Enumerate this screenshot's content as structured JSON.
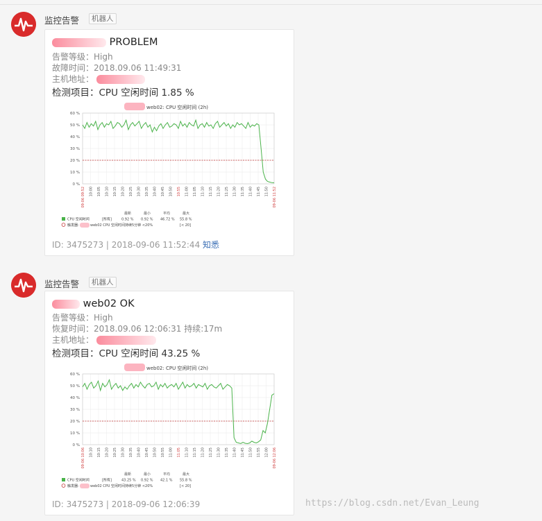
{
  "messages": [
    {
      "sender": "监控告警",
      "bot_tag": "机器人",
      "title": "PROBLEM",
      "level": "告警等级：High",
      "time": "故障时间：2018.09.06 11:49:31",
      "host_label": "主机地址：",
      "check": "检测项目：CPU 空闲时间 1.85 %",
      "chart_title": "web02: CPU 空闲时间 (2h)",
      "legend_header": [
        "最新",
        "最小",
        "平均",
        "最大"
      ],
      "legend_series": "CPU 空闲时间",
      "legend_scope": "[所有]",
      "legend_values": [
        "0.92 %",
        "0.92 %",
        "46.72 %",
        "55.8 %"
      ],
      "trigger_prefix": "触发器:",
      "trigger_text": "web02 CPU 空闲时间持续5分钟 <20%",
      "trigger_bracket": "[< 20]",
      "footer": "ID: 3475273 | 2018-09-06 11:52:44",
      "ack": "知悉"
    },
    {
      "sender": "监控告警",
      "bot_tag": "机器人",
      "title": "web02 OK",
      "level": "告警等级：High",
      "time": "恢复时间：2018.09.06 12:06:31 持续:17m",
      "host_label": "主机地址：",
      "check": "检测项目：CPU 空闲时间 43.25 %",
      "chart_title": "web02: CPU 空闲时间 (2h)",
      "legend_header": [
        "最新",
        "最小",
        "平均",
        "最大"
      ],
      "legend_series": "CPU 空闲时间",
      "legend_scope": "[所有]",
      "legend_values": [
        "43.25 %",
        "0.92 %",
        "42.1 %",
        "55.8 %"
      ],
      "trigger_prefix": "触发器:",
      "trigger_text": "web02 CPU 空闲时间持续5分钟 <20%",
      "trigger_bracket": "[< 20]",
      "footer": "ID: 3475273 | 2018-09-06 12:06:39"
    }
  ],
  "chart_data": [
    {
      "type": "line",
      "title": "web02: CPU 空闲时间 (2h)",
      "yticks": [
        "60 %",
        "50 %",
        "40 %",
        "30 %",
        "20 %",
        "10 %",
        "0 %"
      ],
      "ylim": [
        0,
        60
      ],
      "threshold": 20,
      "xticks": [
        "09-06 09:52",
        "10:00",
        "10:05",
        "10:10",
        "10:15",
        "10:20",
        "10:25",
        "10:30",
        "10:35",
        "10:40",
        "10:45",
        "10:50",
        "10:55",
        "11:00",
        "11:05",
        "11:10",
        "11:15",
        "11:20",
        "11:25",
        "11:30",
        "11:35",
        "11:40",
        "11:45",
        "11:50",
        "09-06 11:52"
      ],
      "series": [
        {
          "name": "CPU 空闲时间",
          "color": "#4ab34a",
          "values": [
            50,
            47,
            52,
            48,
            51,
            49,
            53,
            46,
            50,
            52,
            48,
            51,
            50,
            53,
            47,
            49,
            52,
            51,
            48,
            50,
            54,
            46,
            50,
            52,
            49,
            51,
            53,
            47,
            50,
            52,
            48,
            50,
            44,
            48,
            45,
            49,
            51,
            47,
            50,
            52,
            48,
            49,
            51,
            50,
            47,
            53,
            49,
            51,
            48,
            52,
            50,
            49,
            54,
            47,
            50,
            51,
            48,
            52,
            49,
            50,
            47,
            51,
            53,
            48,
            50,
            52,
            49,
            51,
            47,
            50,
            48,
            52,
            50,
            51,
            49,
            47,
            52,
            48,
            50,
            49,
            51,
            50,
            30,
            10,
            4,
            2,
            1.5,
            1,
            0.9
          ]
        }
      ]
    },
    {
      "type": "line",
      "title": "web02: CPU 空闲时间 (2h)",
      "yticks": [
        "60 %",
        "50 %",
        "40 %",
        "30 %",
        "20 %",
        "10 %",
        "0 %"
      ],
      "ylim": [
        0,
        60
      ],
      "threshold": 20,
      "xticks": [
        "09-06 10:06",
        "10:10",
        "10:15",
        "10:20",
        "10:25",
        "10:30",
        "10:35",
        "10:40",
        "10:45",
        "10:50",
        "10:55",
        "11:00",
        "11:05",
        "11:10",
        "11:15",
        "11:20",
        "11:25",
        "11:30",
        "11:35",
        "11:40",
        "11:45",
        "11:50",
        "11:55",
        "12:00",
        "09-06 12:06"
      ],
      "series": [
        {
          "name": "CPU 空闲时间",
          "color": "#4ab34a",
          "values": [
            49,
            52,
            47,
            51,
            53,
            48,
            50,
            54,
            46,
            52,
            49,
            51,
            55,
            47,
            50,
            52,
            48,
            50,
            46,
            49,
            47,
            50,
            52,
            48,
            51,
            49,
            53,
            50,
            48,
            51,
            52,
            49,
            50,
            53,
            47,
            51,
            49,
            52,
            48,
            50,
            51,
            49,
            52,
            47,
            50,
            53,
            48,
            51,
            49,
            50,
            52,
            48,
            51,
            50,
            49,
            52,
            47,
            50,
            51,
            49,
            48,
            50,
            52,
            47,
            49,
            51,
            50,
            48,
            6,
            2,
            1.5,
            1,
            2,
            1.2,
            0.9,
            1.5,
            3,
            2,
            1.5,
            2.5,
            4,
            12,
            10,
            18,
            30,
            42,
            43.25
          ]
        }
      ]
    }
  ]
}
